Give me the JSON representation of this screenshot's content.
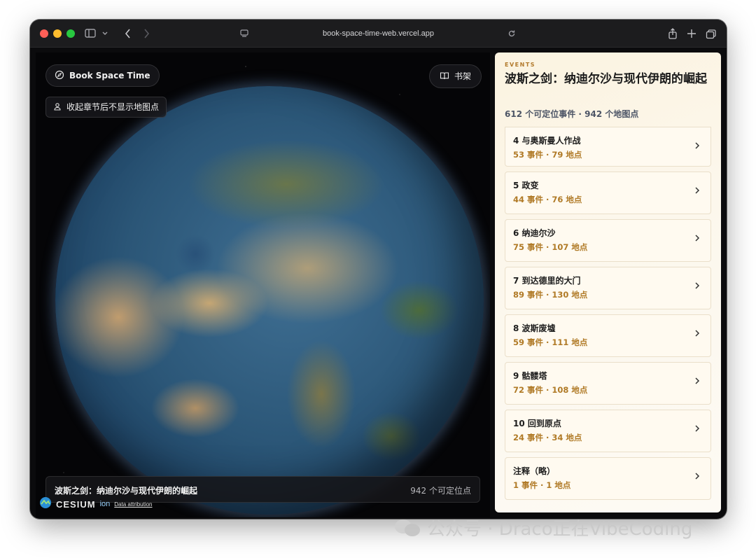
{
  "browser": {
    "url": "book-space-time-web.vercel.app"
  },
  "map": {
    "brand": "Book Space Time",
    "shelf_label": "书架",
    "collapse_label": "收起章节后不显示地图点",
    "bottom_title": "波斯之剑：纳迪尔沙与现代伊朗的崛起",
    "bottom_count": "942 个可定位点",
    "cesium_logo": "CESIUM",
    "cesium_ion": "ion",
    "data_attribution": "Data attribution"
  },
  "panel": {
    "kicker": "EVENTS",
    "title": "波斯之剑：纳迪尔沙与现代伊朗的崛起",
    "stats": "612 个可定位事件 · 942 个地图点",
    "chapters": [
      {
        "title": "4 与奥斯曼人作战",
        "meta": "53 事件 · 79 地点"
      },
      {
        "title": "5 政变",
        "meta": "44 事件 · 76 地点"
      },
      {
        "title": "6 纳迪尔沙",
        "meta": "75 事件 · 107 地点"
      },
      {
        "title": "7 到达德里的大门",
        "meta": "89 事件 · 130 地点"
      },
      {
        "title": "8 波斯废墟",
        "meta": "59 事件 · 111 地点"
      },
      {
        "title": "9 骷髅塔",
        "meta": "72 事件 · 108 地点"
      },
      {
        "title": "10 回到原点",
        "meta": "24 事件 · 34 地点"
      },
      {
        "title": "注释（略）",
        "meta": "1 事件 · 1 地点"
      }
    ]
  },
  "watermark": {
    "text": "公众号 · Draco正在VibeCoding"
  }
}
